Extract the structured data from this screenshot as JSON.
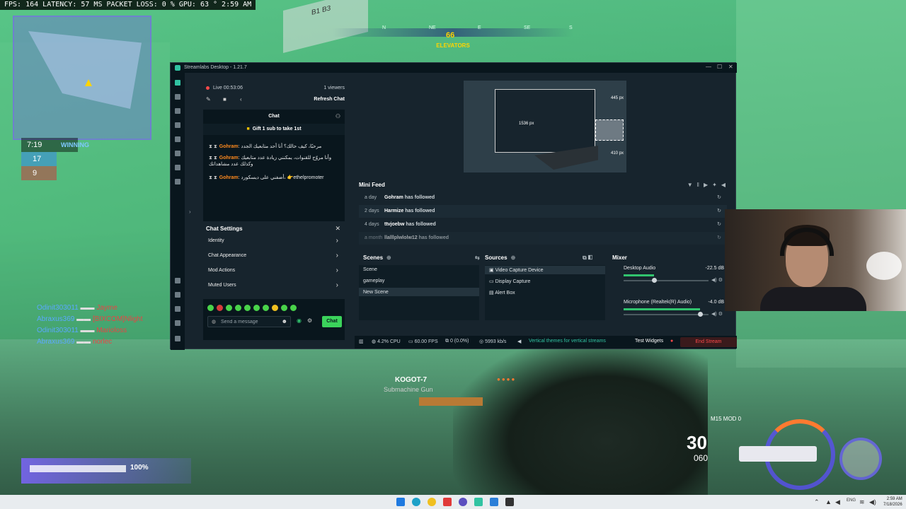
{
  "hud": {
    "top_stats": "FPS: 164  LATENCY: 57 MS  PACKET LOSS: 0 %  GPU: 63 °  2:59 AM",
    "timer": "7:19",
    "team_score": "17",
    "enemy_score": "9",
    "status": "WINNING",
    "compass_dirs": [
      "N",
      "NE",
      "E",
      "SE",
      "S"
    ],
    "heading": "66",
    "location": "ELEVATORS",
    "sign_text": "B1  B3",
    "health_pct_label": "100%",
    "health_value": 1.0,
    "killfeed": [
      {
        "left": "Odinit303011",
        "right": "Jayme"
      },
      {
        "left": "Abraxus369",
        "right": "[BIXCOM]Nlight"
      },
      {
        "left": "Odinit303011",
        "right": "Marioloss"
      },
      {
        "left": "Abraxus369",
        "right": "norlec"
      }
    ],
    "pickup_name": "KOGOT-7",
    "pickup_class": "Submachine Gun",
    "weapon_mod": "M15 MOD 0",
    "ammo_mag": "30",
    "ammo_reserve": "060"
  },
  "window": {
    "title": "Streamlabs Desktop - 1.21.7",
    "minimize": "—",
    "maximize": "☐",
    "close": "✕"
  },
  "chat": {
    "live_time": "Live 00:53:06",
    "viewers": "1 viewers",
    "refresh": "Refresh Chat",
    "title": "Chat",
    "gift_banner": "Gift 1 sub to take 1st",
    "messages": [
      {
        "badges": "⧗ ⧗",
        "user": "Gohram",
        "text": ": مرحبًا، كيف حالك؟ أنا أحد متابعيك الجدد"
      },
      {
        "badges": "⧗ ⧗",
        "user": "Gohram",
        "text": ": وأنا مروّج للقنوات، يمكنني زيادة عدد متابعيك وكذلك عدد مشاهداتك"
      },
      {
        "badges": "⧗ ⧗",
        "user": "Gohram",
        "text": ": أضفني على ديسكورد، 👉ethelpromoter"
      }
    ],
    "settings_title": "Chat Settings",
    "settings_close": "✕",
    "settings_items": [
      "Identity",
      "Chat Appearance",
      "Mod Actions",
      "Muted Users"
    ],
    "input_placeholder": "Send a message",
    "send_label": "Chat"
  },
  "preview": {
    "label_width": "1536 px",
    "label_right_top": "445 px",
    "label_right_bottom": "410 px"
  },
  "minifeed": {
    "title": "Mini Feed",
    "rows": [
      {
        "ago": "a day",
        "user": "Gohram",
        "action": "has followed"
      },
      {
        "ago": "2 days",
        "user": "Harmize",
        "action": "has followed"
      },
      {
        "ago": "4 days",
        "user": "ttvjoebw",
        "action": "has followed"
      },
      {
        "ago": "a month",
        "user": "llalllplwlolw12",
        "action": "has followed"
      }
    ]
  },
  "scenes": {
    "title": "Scenes",
    "items": [
      "Scene",
      "gameplay",
      "New Scene"
    ],
    "selected": "New Scene"
  },
  "sources": {
    "title": "Sources",
    "items": [
      "Video Capture Device",
      "Display Capture",
      "Alert Box"
    ]
  },
  "mixer": {
    "title": "Mixer",
    "channels": [
      {
        "name": "Desktop Audio",
        "db": "-22.5 dB",
        "level": 0.36
      },
      {
        "name": "Microphone (Realtek(R) Audio)",
        "db": "-4.0 dB",
        "level": 0.9
      }
    ]
  },
  "statusbar": {
    "cpu": "4.2% CPU",
    "fps": "60.00 FPS",
    "dropped": "0 (0.0%)",
    "bitrate": "5993 kb/s",
    "vertical_themes": "Vertical themes for vertical streams",
    "test_widgets": "Test Widgets",
    "end_stream": "End Stream"
  },
  "taskbar": {
    "lang": "ENG",
    "time": "2:59 AM",
    "date": "7/18/2026"
  },
  "colors": {
    "accent": "#31c3a2",
    "live": "#ff4a4a",
    "username": "#ff8a1e",
    "send": "#3bd35b"
  }
}
